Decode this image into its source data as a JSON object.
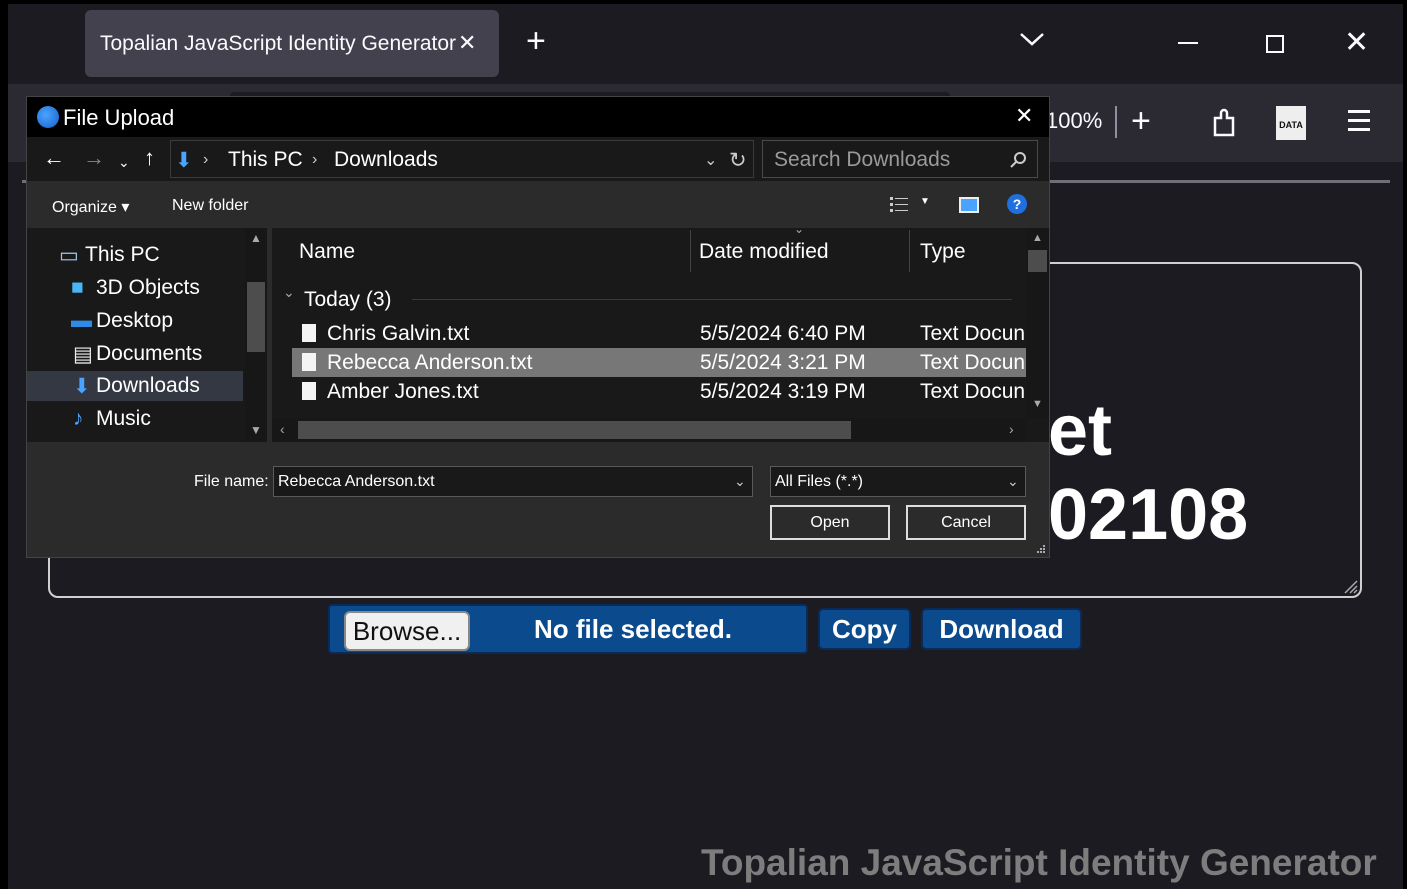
{
  "browser": {
    "tab_title": "Topalian JavaScript Identity Generator",
    "tab_close": "✕",
    "new_tab": "+",
    "zoom": "100%",
    "toolbar_plus": "+",
    "data_badge": "DATA"
  },
  "page": {
    "big_text_1": "et",
    "big_text_2": "02108",
    "browse_label": "Browse...",
    "no_file": "No file selected.",
    "copy_label": "Copy",
    "download_label": "Download",
    "footer_title": "Topalian JavaScript Identity Generator"
  },
  "dialog": {
    "title": "File Upload",
    "close": "✕",
    "breadcrumb": [
      "This PC",
      "Downloads"
    ],
    "search_placeholder": "Search Downloads",
    "organize": "Organize ▾",
    "new_folder": "New folder",
    "help": "?",
    "nav_items": [
      {
        "label": "This PC",
        "icon": "computer-icon"
      },
      {
        "label": "3D Objects",
        "icon": "cube-icon"
      },
      {
        "label": "Desktop",
        "icon": "desktop-icon"
      },
      {
        "label": "Documents",
        "icon": "document-icon"
      },
      {
        "label": "Downloads",
        "icon": "download-icon",
        "selected": true
      },
      {
        "label": "Music",
        "icon": "music-icon"
      }
    ],
    "columns": [
      "Name",
      "Date modified",
      "Type"
    ],
    "group_label": "Today (3)",
    "files": [
      {
        "name": "Chris Galvin.txt",
        "date": "5/5/2024 6:40 PM",
        "type": "Text Docun"
      },
      {
        "name": "Rebecca Anderson.txt",
        "date": "5/5/2024 3:21 PM",
        "type": "Text Docun",
        "selected": true
      },
      {
        "name": "Amber Jones.txt",
        "date": "5/5/2024 3:19 PM",
        "type": "Text Docun"
      }
    ],
    "file_name_label": "File name:",
    "file_name_value": "Rebecca Anderson.txt",
    "file_type_value": "All Files (*.*)",
    "open_label": "Open",
    "cancel_label": "Cancel"
  },
  "colors": {
    "accent_blue": "#0b4a8c",
    "selected_row": "#777777",
    "footer_text": "#7d7d7d"
  }
}
